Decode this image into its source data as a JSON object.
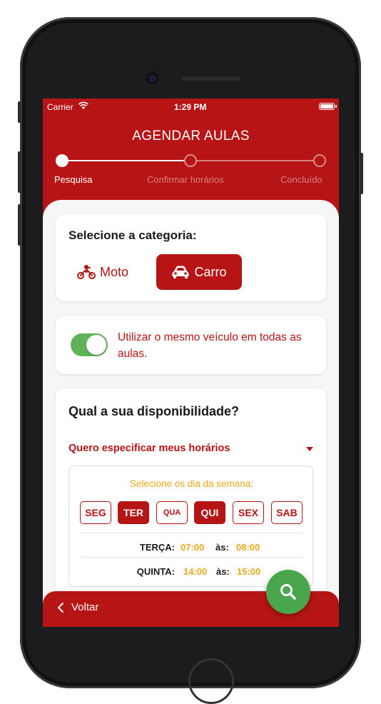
{
  "status_bar": {
    "carrier": "Carrier",
    "time": "1:29 PM"
  },
  "header": {
    "title": "AGENDAR AULAS"
  },
  "stepper": {
    "steps": [
      {
        "label": "Pesquisa",
        "state": "active"
      },
      {
        "label": "Confirmar horários",
        "state": "pending"
      },
      {
        "label": "Concluído",
        "state": "pending"
      }
    ]
  },
  "category": {
    "title": "Selecione a categoria:",
    "options": [
      {
        "label": "Moto",
        "icon": "motorcycle-icon",
        "selected": false
      },
      {
        "label": "Carro",
        "icon": "car-icon",
        "selected": true
      }
    ]
  },
  "vehicle_toggle": {
    "label": "Utilizar o mesmo veículo em todas as aulas.",
    "on": true
  },
  "availability": {
    "title": "Qual a sua disponibilidade?",
    "dropdown_value": "Quero especificar meus horários",
    "days_title": "Selecione os dia da semana:",
    "days": [
      {
        "label": "SEG",
        "selected": false
      },
      {
        "label": "TER",
        "selected": true
      },
      {
        "label": "QUA",
        "selected": false
      },
      {
        "label": "QUI",
        "selected": true
      },
      {
        "label": "SEX",
        "selected": false
      },
      {
        "label": "SAB",
        "selected": false
      }
    ],
    "schedule": [
      {
        "day": "TERÇA:",
        "start": "07:00",
        "sep": "às:",
        "end": "08:00"
      },
      {
        "day": "QUINTA:",
        "start": "14:00",
        "sep": "às:",
        "end": "15:00"
      }
    ]
  },
  "footer": {
    "back_label": "Voltar"
  },
  "fab": {
    "icon": "search-icon"
  },
  "colors": {
    "primary": "#b71515",
    "accent_yellow": "#eaaa1e",
    "toggle_green": "#5fb257",
    "fab_green": "#4aa64d"
  }
}
